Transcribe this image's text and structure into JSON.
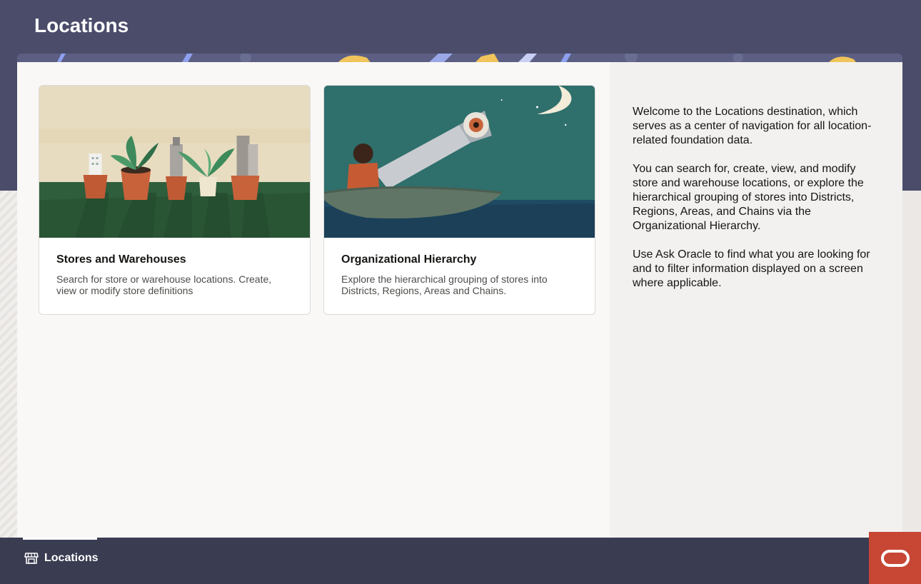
{
  "page": {
    "title": "Locations"
  },
  "cards": [
    {
      "title": "Stores and Warehouses",
      "description": "Search for store or warehouse locations. Create, view or modify store definitions",
      "image": "potted-plants-with-buildings-illustration"
    },
    {
      "title": "Organizational Hierarchy",
      "description": "Explore the hierarchical grouping of stores into Districts, Regions, Areas and Chains.",
      "image": "person-in-boat-with-telescope-illustration"
    }
  ],
  "info": {
    "paragraphs": [
      "Welcome to the Locations destination, which serves as a center of navigation for all location-related foundation data.",
      "You can search for, create, view, and modify store and warehouse locations, or explore the hierarchical grouping of stores into Districts, Regions, Areas, and Chains via the Organizational Hierarchy.",
      "Use Ask Oracle to find what you are looking for and to filter information displayed on a screen where applicable."
    ]
  },
  "footer": {
    "nav_label": "Locations",
    "nav_icon": "store-icon",
    "oracle_button_icon": "oracle-logo-icon"
  },
  "colors": {
    "header_bg": "#4a4c6a",
    "footer_bg": "#3a3c52",
    "oracle_red": "#c74634"
  }
}
